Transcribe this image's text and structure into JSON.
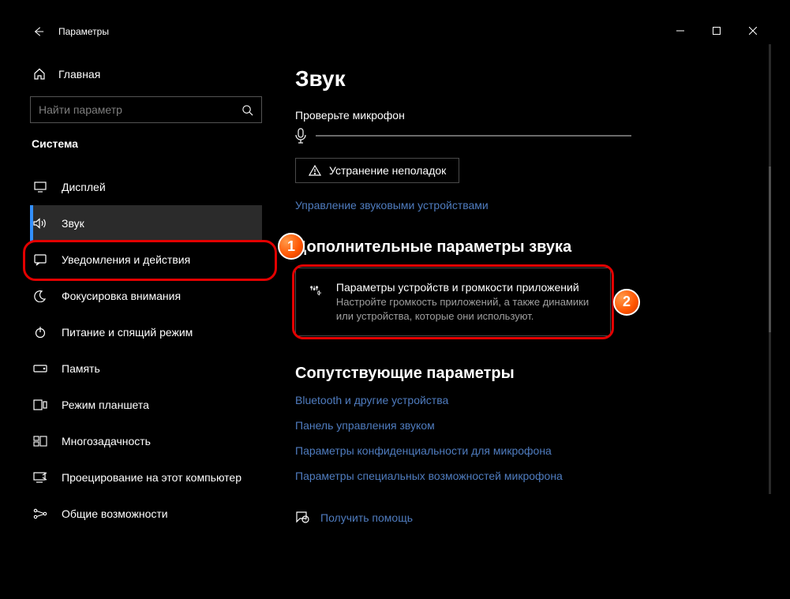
{
  "window": {
    "title": "Параметры"
  },
  "sidebar": {
    "home_label": "Главная",
    "search_placeholder": "Найти параметр",
    "group_label": "Система",
    "items": [
      {
        "label": "Дисплей"
      },
      {
        "label": "Звук"
      },
      {
        "label": "Уведомления и действия"
      },
      {
        "label": "Фокусировка внимания"
      },
      {
        "label": "Питание и спящий режим"
      },
      {
        "label": "Память"
      },
      {
        "label": "Режим планшета"
      },
      {
        "label": "Многозадачность"
      },
      {
        "label": "Проецирование на этот компьютер"
      },
      {
        "label": "Общие возможности"
      }
    ]
  },
  "main": {
    "title": "Звук",
    "mic_check_label": "Проверьте микрофон",
    "troubleshoot_label": "Устранение неполадок",
    "device_mgmt_link": "Управление звуковыми устройствами",
    "advanced_header": "Дополнительные параметры звука",
    "pref_card": {
      "title": "Параметры устройств и громкости приложений",
      "description": "Настройте громкость приложений, а также динамики или устройства, которые они используют."
    },
    "related_header": "Сопутствующие параметры",
    "related_links": [
      "Bluetooth и другие устройства",
      "Панель управления звуком",
      "Параметры конфиденциальности для микрофона",
      "Параметры специальных возможностей микрофона"
    ],
    "help_link": "Получить помощь"
  },
  "annotations": {
    "badge1": "1",
    "badge2": "2"
  }
}
